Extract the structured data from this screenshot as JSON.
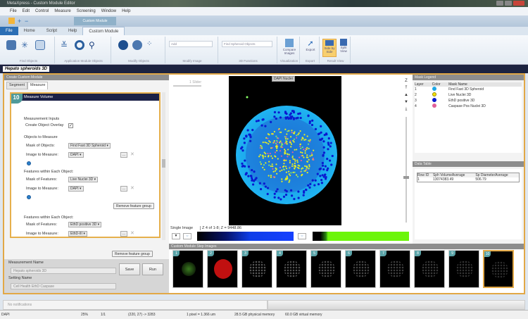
{
  "window": {
    "title": "MetaXpress - Custom Module Editor"
  },
  "menu": [
    "File",
    "Edit",
    "Control",
    "Measure",
    "Screening",
    "Window",
    "Help"
  ],
  "ribbon": {
    "contextual_label": "Custom Module",
    "tabs": [
      "File",
      "Home",
      "Script",
      "Help",
      "Custom Module"
    ],
    "groups": [
      "Find Objects",
      "Application Module Objects",
      "Modify Objects",
      "Modify Image",
      "3D Functions",
      "Visualization",
      "Export",
      "Result View"
    ],
    "modify_image_field": "Add",
    "functions_field": "Find Spheroid Objects",
    "buttons": {
      "compare": "Compare Images",
      "export": "Export",
      "side_by_side": "Side by Side",
      "split": "Split View"
    }
  },
  "document_tab": "Hepato spheroids 3D",
  "left": {
    "header": "Create Custom Module",
    "tabs": [
      "Segment",
      "Measure"
    ],
    "step": {
      "number": "10",
      "title": "Measure Volume",
      "measurement_inputs": "Measurement Inputs",
      "create_overlay_label": "Create Object Overlay",
      "create_overlay_checked": true,
      "objects_section": "Objects to Measure",
      "mask_of_objects_label": "Mask of Objects:",
      "mask_of_objects": "Find Fast 3D Spheroid",
      "image_label": "Image to Measure:",
      "image1": "DAPI",
      "features1_title": "Features within Each Object:",
      "mask_features_label": "Mask of Features:",
      "mask_features1": "Live Nuclei 3D",
      "image2": "DAPI",
      "remove_label": "Remove feature group",
      "mask_features2": "EthD positive 3D",
      "image3": "EthD-III"
    },
    "measurement_name_label": "Measurement Name",
    "measurement_name": "Hepato spheroids 3D",
    "setting_name_label": "Setting Name",
    "setting_name": "Cell Health EthD Caspase",
    "save": "Save",
    "run": "Run"
  },
  "viewer": {
    "channel_label": "DAPI Nuclei",
    "zoom_box": "1 Slider",
    "z_label": "Z",
    "mode": "Single Image",
    "z_readout": "Z 4 of 1-8; Z = 9448.86"
  },
  "mask_legend": {
    "title": "Mask Legend",
    "columns": [
      "Layer",
      "Color",
      "Mask Name"
    ],
    "rows": [
      {
        "layer": "1",
        "color": "#1fa8e6",
        "name": "Find Fast 3D Spheroid"
      },
      {
        "layer": "2",
        "color": "#f2e200",
        "name": "Live Nuclei 3D"
      },
      {
        "layer": "3",
        "color": "#0a1ad0",
        "name": "EthD positive 3D"
      },
      {
        "layer": "4",
        "color": "#e0609a",
        "name": "Caspase Pos Nuclei 3D"
      }
    ]
  },
  "data_table": {
    "title": "Data Table",
    "columns": [
      "Row ID",
      "Sph VolumeAverage",
      "Sp DiameterAverage"
    ],
    "rows": [
      [
        "1",
        "13074383.49",
        "506.79"
      ]
    ]
  },
  "strip": {
    "title": "Custom Module Step Images",
    "steps": [
      "1",
      "2",
      "3",
      "4",
      "5",
      "6",
      "7",
      "8",
      "9",
      "10"
    ]
  },
  "notifications": "No notifications",
  "status": {
    "channel": "DAPI",
    "zoom": "25%",
    "page": "1/1",
    "coord": "(220, 27) -> 3283",
    "scale": "1 pixel = 1.366 um",
    "physical": "28.5 GB physical memory",
    "virtual": "60.0 GB virtual memory"
  },
  "colors": {
    "accent": "#e2a846",
    "navy": "#1b2146",
    "file_tab": "#2c6fb5"
  }
}
